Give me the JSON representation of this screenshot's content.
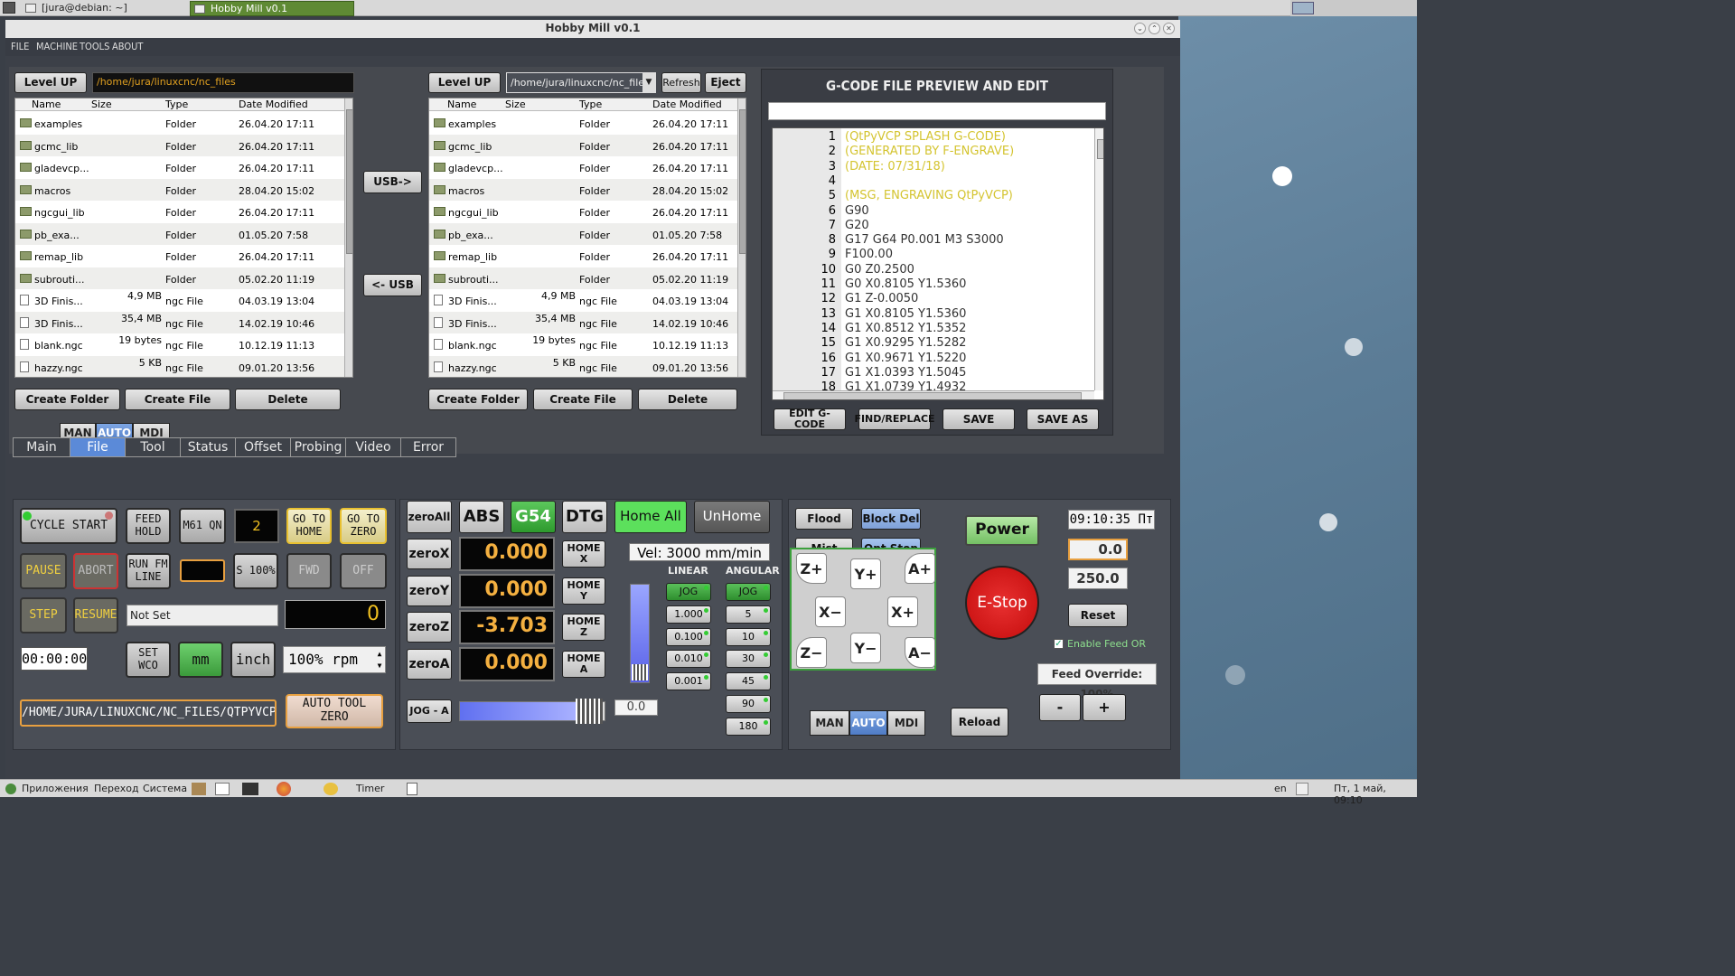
{
  "system": {
    "task_terminal": "[jura@debian: ~]",
    "task_app": "Hobby Mill v0.1",
    "taskbar": {
      "apps": "Приложения",
      "go": "Переход",
      "system": "Система",
      "timer": "Timer",
      "lang": "en",
      "clock": "Пт, 1 май, 09:10"
    }
  },
  "window": {
    "title": "Hobby Mill v0.1",
    "min": "⌄",
    "max": "⌃",
    "close": "✕"
  },
  "menubar": [
    "FILE",
    "MACHINE",
    "TOOLS",
    "ABOUT"
  ],
  "file_left": {
    "level_up": "Level UP",
    "path": "/home/jura/linuxcnc/nc_files",
    "headers": [
      "Name",
      "Size",
      "Type",
      "Date Modified"
    ],
    "rows": [
      {
        "name": "examples",
        "size": "",
        "type": "Folder",
        "date": "26.04.20 17:11",
        "kind": "folder"
      },
      {
        "name": "gcmc_lib",
        "size": "",
        "type": "Folder",
        "date": "26.04.20 17:11",
        "kind": "folder"
      },
      {
        "name": "gladevcp...",
        "size": "",
        "type": "Folder",
        "date": "26.04.20 17:11",
        "kind": "folder"
      },
      {
        "name": "macros",
        "size": "",
        "type": "Folder",
        "date": "28.04.20 15:02",
        "kind": "folder"
      },
      {
        "name": "ngcgui_lib",
        "size": "",
        "type": "Folder",
        "date": "26.04.20 17:11",
        "kind": "folder"
      },
      {
        "name": "pb_exa...",
        "size": "",
        "type": "Folder",
        "date": "01.05.20 7:58",
        "kind": "folder"
      },
      {
        "name": "remap_lib",
        "size": "",
        "type": "Folder",
        "date": "26.04.20 17:11",
        "kind": "folder"
      },
      {
        "name": "subrouti...",
        "size": "",
        "type": "Folder",
        "date": "05.02.20 11:19",
        "kind": "folder"
      },
      {
        "name": "3D Finis...",
        "size": "4,9 MB",
        "type": "ngc File",
        "date": "04.03.19 13:04",
        "kind": "file"
      },
      {
        "name": "3D Finis...",
        "size": "35,4 MB",
        "type": "ngc File",
        "date": "14.02.19 10:46",
        "kind": "file"
      },
      {
        "name": "blank.ngc",
        "size": "19 bytes",
        "type": "ngc File",
        "date": "10.12.19 11:13",
        "kind": "file"
      },
      {
        "name": "hazzy.ngc",
        "size": "5 KB",
        "type": "ngc File",
        "date": "09.01.20 13:56",
        "kind": "file"
      }
    ],
    "create_folder": "Create Folder",
    "create_file": "Create File",
    "delete": "Delete"
  },
  "file_right": {
    "level_up": "Level UP",
    "path": "/home/jura/linuxcnc/nc_files",
    "refresh": "Refresh",
    "eject": "Eject",
    "create_folder": "Create Folder",
    "create_file": "Create File",
    "delete": "Delete"
  },
  "usb": {
    "to": "USB->",
    "from": "<- USB"
  },
  "mode_left": [
    "MAN",
    "AUTO",
    "MDI"
  ],
  "gcode": {
    "title": "G-CODE FILE PREVIEW AND EDIT",
    "lines": [
      "(QtPyVCP SPLASH G-CODE)",
      "(GENERATED BY F-ENGRAVE)",
      "(DATE: 07/31/18)",
      "",
      "(MSG, ENGRAVING QtPyVCP)",
      "G90",
      "G20",
      "G17 G64 P0.001 M3 S3000",
      "F100.00",
      "G0 Z0.2500",
      "G0 X0.8105 Y1.5360",
      "G1 Z-0.0050",
      "G1 X0.8105 Y1.5360",
      "G1 X0.8512 Y1.5352",
      "G1 X0.9295 Y1.5282",
      "G1 X0.9671 Y1.5220",
      "G1 X1.0393 Y1.5045",
      "G1 X1.0739 Y1.4932"
    ],
    "edit": "EDIT G-CODE",
    "find": "FIND/REPLACE",
    "save": "SAVE",
    "save_as": "SAVE AS"
  },
  "tabs": [
    "Main",
    "File",
    "Tool",
    "Status",
    "Offset",
    "Probing",
    "Video",
    "Error"
  ],
  "control": {
    "cycle_start": "CYCLE START",
    "feed_hold": "FEED HOLD",
    "m61": "M61 QN",
    "tool_num": "2",
    "go_home": "GO TO HOME",
    "go_zero": "GO TO ZERO",
    "pause": "PAUSE",
    "abort": "ABORT",
    "run_fm": "RUN FM LINE",
    "s100": "S 100%",
    "fwd": "FWD",
    "off": "OFF",
    "step": "STEP",
    "resume": "RESUME",
    "not_set": "Not Set",
    "line_num": "0",
    "timer": "00:00:00",
    "set_wco": "SET WCO",
    "mm": "mm",
    "inch": "inch",
    "rpm": "100% rpm",
    "file_path": "/HOME/JURA/LINUXCNC/NC_FILES/QTPYVCP.NGC",
    "auto_tool_zero": "AUTO TOOL ZERO"
  },
  "dro": {
    "zero_all": "zeroAll",
    "abs": "ABS",
    "g54": "G54",
    "dtg": "DTG",
    "home_all": "Home All",
    "unhome": "UnHome",
    "axes": [
      {
        "zero": "zeroX",
        "value": "0.000",
        "home": "HOME X"
      },
      {
        "zero": "zeroY",
        "value": "0.000",
        "home": "HOME Y"
      },
      {
        "zero": "zeroZ",
        "value": "-3.703",
        "home": "HOME Z"
      },
      {
        "zero": "zeroA",
        "value": "0.000",
        "home": "HOME A"
      }
    ],
    "vel": "Vel: 3000 mm/min",
    "linear": "LINEAR",
    "angular": "ANGULAR",
    "linear_steps": [
      "JOG",
      "1.000",
      "0.100",
      "0.010",
      "0.001"
    ],
    "angular_steps": [
      "JOG",
      "5",
      "10",
      "30",
      "45",
      "90",
      "180"
    ],
    "jog_a": "JOG - A",
    "jog_a_val": "0.0"
  },
  "machine": {
    "flood": "Flood",
    "block_del": "Block Del",
    "mist": "Mist",
    "opt_stop": "Opt Stop",
    "power": "Power",
    "estop": "E-Stop",
    "clock": "09:10:35 Пт",
    "feed_val": "0.0",
    "feed_max": "250.0",
    "reset": "Reset",
    "enable_feed": "Enable Feed OR",
    "feed_override": "Feed Override: 100%",
    "minus": "-",
    "plus": "+",
    "reload": "Reload",
    "jog": {
      "zp": "Z+",
      "yp": "Y+",
      "ap": "A+",
      "xm": "X−",
      "xp": "X+",
      "zm": "Z−",
      "ym": "Y−",
      "am": "A−"
    },
    "mode": [
      "MAN",
      "AUTO",
      "MDI"
    ]
  }
}
